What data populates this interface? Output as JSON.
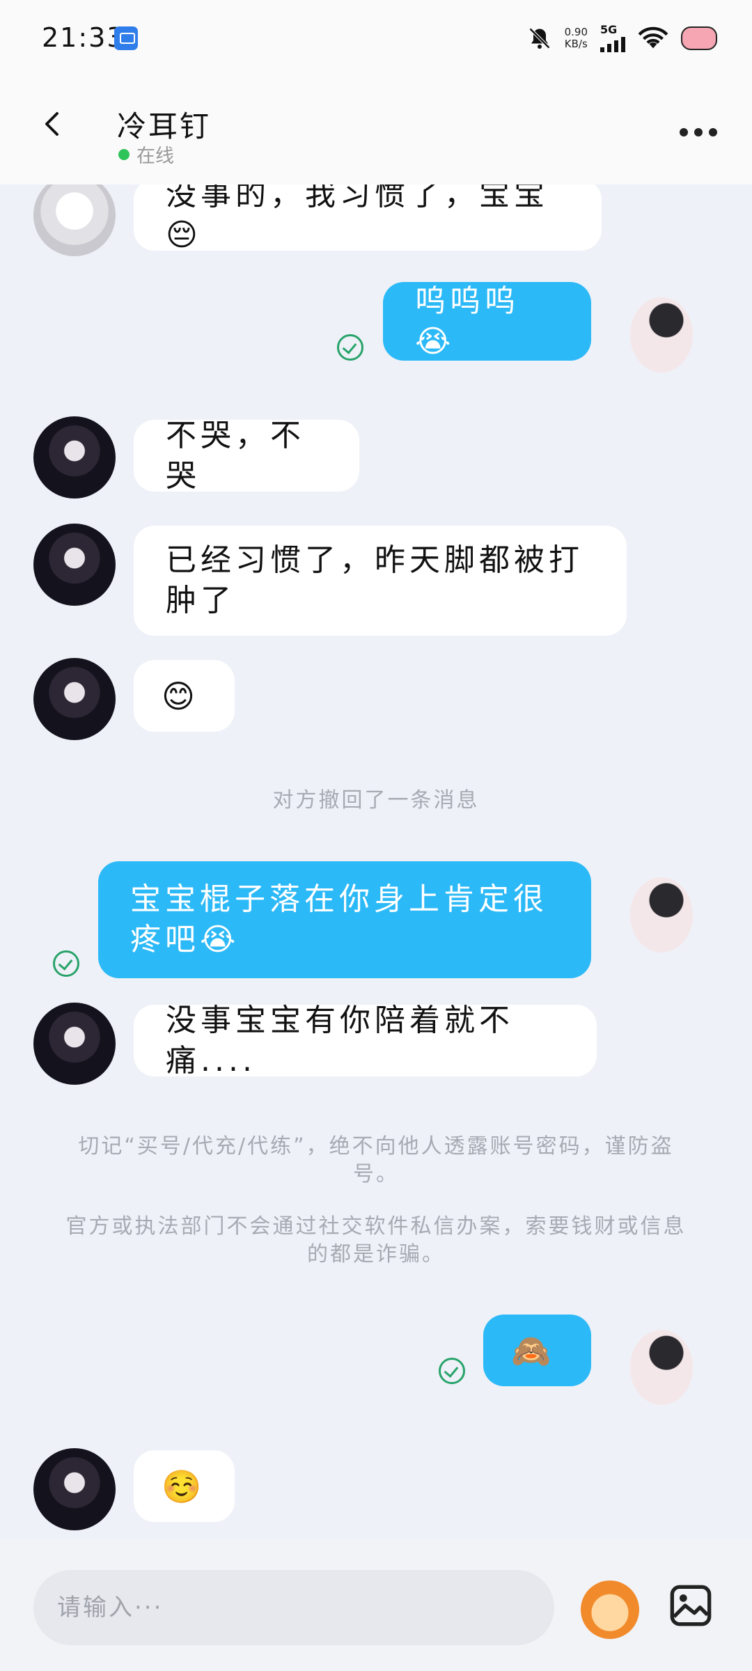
{
  "status_bar": {
    "time": "21:33",
    "net_speed_value": "0.90",
    "net_speed_unit": "KB/s",
    "network": "5G",
    "icons": [
      "app-icon",
      "mute-bell-icon",
      "signal-icon",
      "wifi-icon",
      "battery-icon"
    ]
  },
  "header": {
    "contact_name": "冷耳钉",
    "presence": "在线",
    "presence_color": "#2ec45a"
  },
  "messages": [
    {
      "from": "contact",
      "text": "没事的，我习惯了，宝宝😔"
    },
    {
      "from": "me",
      "text": "呜呜呜😭",
      "read": true
    },
    {
      "from": "contact",
      "text": "不哭，不哭"
    },
    {
      "from": "contact",
      "text": "已经习惯了，昨天脚都被打肿了"
    },
    {
      "from": "contact",
      "text": "😊"
    },
    {
      "from": "system",
      "text": "对方撤回了一条消息"
    },
    {
      "from": "me",
      "text": "宝宝棍子落在你身上肯定很疼吧😭",
      "read": true
    },
    {
      "from": "contact",
      "text": "没事宝宝有你陪着就不痛...."
    },
    {
      "from": "system",
      "text": "切记“买号/代充/代练”，绝不向他人透露账号密码，谨防盗号。"
    },
    {
      "from": "system",
      "text": "官方或执法部门不会通过社交软件私信办案，索要钱财或信息的都是诈骗。"
    },
    {
      "from": "me",
      "text": "🙈",
      "read": true
    },
    {
      "from": "contact",
      "text": "☺️"
    }
  ],
  "input": {
    "placeholder": "请输入···"
  },
  "colors": {
    "outgoing_bubble": "#2cb9f7",
    "incoming_bubble": "#ffffff",
    "background": "#eef1f7",
    "read_check": "#27a36a"
  }
}
